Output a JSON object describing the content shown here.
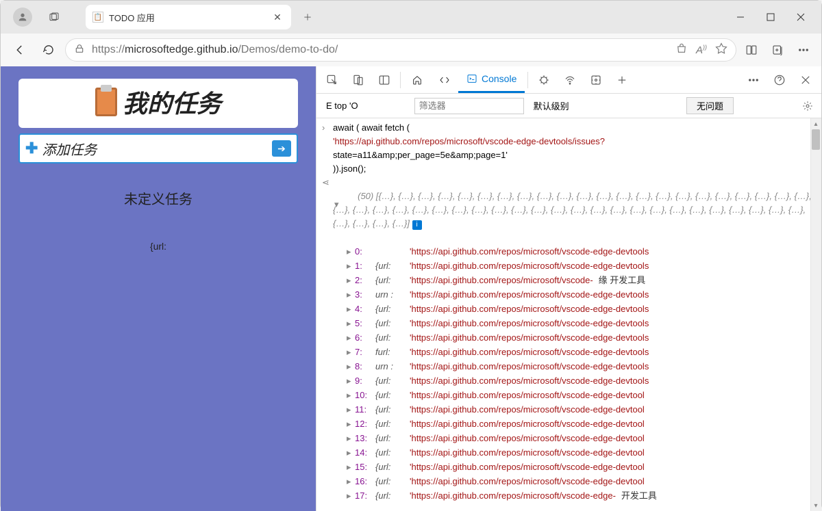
{
  "browser": {
    "tab_title": "TODO 应用",
    "url_host": "microsoftedge.github.io",
    "url_path": "/Demos/demo-to-do/",
    "url_prefix": "https://"
  },
  "page": {
    "title": "我的任务",
    "add_task": "添加任务",
    "undefined_task": "未定义任务",
    "url_placeholder": "{url:"
  },
  "devtools": {
    "console_label": "Console",
    "top_context": "top",
    "eye_label": "E",
    "o_label": "'O",
    "filter_placeholder": "筛选器",
    "default_levels": "默认级别",
    "no_issues": "无问题",
    "code_line1": "await ( await fetch (",
    "code_url": "'https://api.github.com/repos/microsoft/vscode-edge-devtools/issues?",
    "code_line2": "state=a11&amp;per_page=5e&amp;page=1'",
    "code_line3": ")).json();",
    "result_count": "(50)",
    "summary_objs": " [{…}, {…}, {…}, {…}, {…}, {…}, {…}, {…}, {…}, {…}, {…}, {…}, {…}, {…}, {…}, {…}, {…}, {…}, {…}, {…}, {…}, {…}, {…}, {…}, {…}, {…}, {…}, {…}, {…}, {…}, {…}, {…}, {…}, {…}, {…}, {…}, {…}, {…}, {…}, {…}, {…}, {…}, {…}, {…}, {…}, {…}, {…}, {…}, {…}, {…}]",
    "entries": [
      {
        "idx": "0:",
        "key": "",
        "val": "'https://api.github.com/repos/microsoft/vscode-edge-devtools",
        "trail": ""
      },
      {
        "idx": "1:",
        "key": "{url:",
        "val": "'https://api.github.com/repos/microsoft/vscode-edge-devtools",
        "trail": ""
      },
      {
        "idx": "2:",
        "key": "{url:",
        "val": "'https://api.github.com/repos/microsoft/vscode-",
        "trail": "缘    开发工具"
      },
      {
        "idx": "3:",
        "key": "urn :",
        "val": "'https://api.github.com/repos/microsoft/vscode-edge-devtools",
        "trail": ""
      },
      {
        "idx": "4:",
        "key": "{url:",
        "val": "'https://api.github.com/repos/microsoft/vscode-edge-devtools",
        "trail": ""
      },
      {
        "idx": "5:",
        "key": "{url:",
        "val": "'https://api.github.com/repos/microsoft/vscode-edge-devtools",
        "trail": ""
      },
      {
        "idx": "6:",
        "key": "{url:",
        "val": "'https://api.github.com/repos/microsoft/vscode-edge-devtools",
        "trail": ""
      },
      {
        "idx": "7:",
        "key": "furl:",
        "val": "'https://api.github.com/repos/microsoft/vscode-edge-devtools",
        "trail": ""
      },
      {
        "idx": "8:",
        "key": "urn :",
        "val": "'https://api.github.com/repos/microsoft/vscode-edge-devtools",
        "trail": ""
      },
      {
        "idx": "9:",
        "key": "{url:",
        "val": "'https://api.github.com/repos/microsoft/vscode-edge-devtools",
        "trail": ""
      },
      {
        "idx": "10:",
        "key": "{url:",
        "val": "'https://api.github.com/repos/microsoft/vscode-edge-devtool",
        "trail": ""
      },
      {
        "idx": "11:",
        "key": "{url:",
        "val": "'https://api.github.com/repos/microsoft/vscode-edge-devtool",
        "trail": ""
      },
      {
        "idx": "12:",
        "key": "{url:",
        "val": "'https://api.github.com/repos/microsoft/vscode-edge-devtool",
        "trail": ""
      },
      {
        "idx": "13:",
        "key": "{url:",
        "val": "'https://api.github.com/repos/microsoft/vscode-edge-devtool",
        "trail": ""
      },
      {
        "idx": "14:",
        "key": "{url:",
        "val": "'https://api.github.com/repos/microsoft/vscode-edge-devtool",
        "trail": ""
      },
      {
        "idx": "15:",
        "key": "{url:",
        "val": "'https://api.github.com/repos/microsoft/vscode-edge-devtool",
        "trail": ""
      },
      {
        "idx": "16:",
        "key": "{url:",
        "val": "'https://api.github.com/repos/microsoft/vscode-edge-devtool",
        "trail": ""
      },
      {
        "idx": "17:",
        "key": "{url:",
        "val": "'https://api.github.com/repos/microsoft/vscode-edge-",
        "trail": "开发工具"
      }
    ]
  }
}
